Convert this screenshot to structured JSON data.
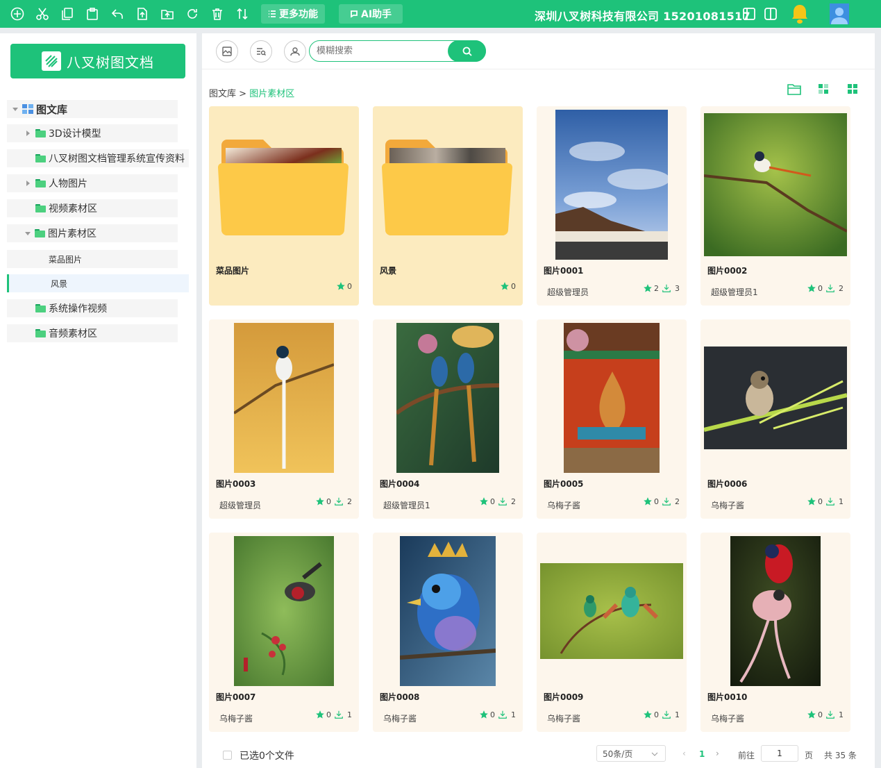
{
  "toolbar": {
    "icons": [
      "plus-icon",
      "cut-icon",
      "copy-icon",
      "paste-icon",
      "undo-icon",
      "upload-file-icon",
      "upload-folder-icon",
      "refresh-icon",
      "delete-icon",
      "sort-icon"
    ],
    "more_label": "更多功能",
    "ai_label": "AI助手",
    "company": "深圳八叉树科技有限公司 15201081517"
  },
  "sidebar": {
    "brand": "八叉树图文档",
    "root": "图文库",
    "items": [
      {
        "label": "3D设计模型"
      },
      {
        "label": "八叉树图文档管理系统宣传资料"
      },
      {
        "label": "人物图片"
      },
      {
        "label": "视频素材区"
      },
      {
        "label": "图片素材区"
      },
      {
        "label": "菜品图片"
      },
      {
        "label": "风景"
      },
      {
        "label": "系统操作视频"
      },
      {
        "label": "音频素材区"
      }
    ]
  },
  "search": {
    "placeholder": "模糊搜索"
  },
  "breadcrumb": {
    "root": "图文库",
    "sep": " > ",
    "current": "图片素材区"
  },
  "cards": [
    {
      "title": "菜品图片",
      "owner": "",
      "stars": "0",
      "downloads": ""
    },
    {
      "title": "风景",
      "owner": "",
      "stars": "0",
      "downloads": ""
    },
    {
      "title": "图片0001",
      "owner": "超级管理员",
      "stars": "2",
      "downloads": "3"
    },
    {
      "title": "图片0002",
      "owner": "超级管理员1",
      "stars": "0",
      "downloads": "2"
    },
    {
      "title": "图片0003",
      "owner": "超级管理员",
      "stars": "0",
      "downloads": "2"
    },
    {
      "title": "图片0004",
      "owner": "超级管理员1",
      "stars": "0",
      "downloads": "2"
    },
    {
      "title": "图片0005",
      "owner": "乌梅子酱",
      "stars": "0",
      "downloads": "2"
    },
    {
      "title": "图片0006",
      "owner": "乌梅子酱",
      "stars": "0",
      "downloads": "1"
    },
    {
      "title": "图片0007",
      "owner": "乌梅子酱",
      "stars": "0",
      "downloads": "1"
    },
    {
      "title": "图片0008",
      "owner": "乌梅子酱",
      "stars": "0",
      "downloads": "1"
    },
    {
      "title": "图片0009",
      "owner": "乌梅子酱",
      "stars": "0",
      "downloads": "1"
    },
    {
      "title": "图片0010",
      "owner": "乌梅子酱",
      "stars": "0",
      "downloads": "1"
    }
  ],
  "footer": {
    "selected": "已选0个文件",
    "page_size": "50条/页",
    "current_page": "1",
    "goto_label": "前往",
    "goto_value": "1",
    "page_unit": "页",
    "total": "共 35 条"
  },
  "colors": {
    "accent": "#1ec27a",
    "folder_bg": "#fcebbf",
    "card_bg": "#fdf6ec"
  }
}
